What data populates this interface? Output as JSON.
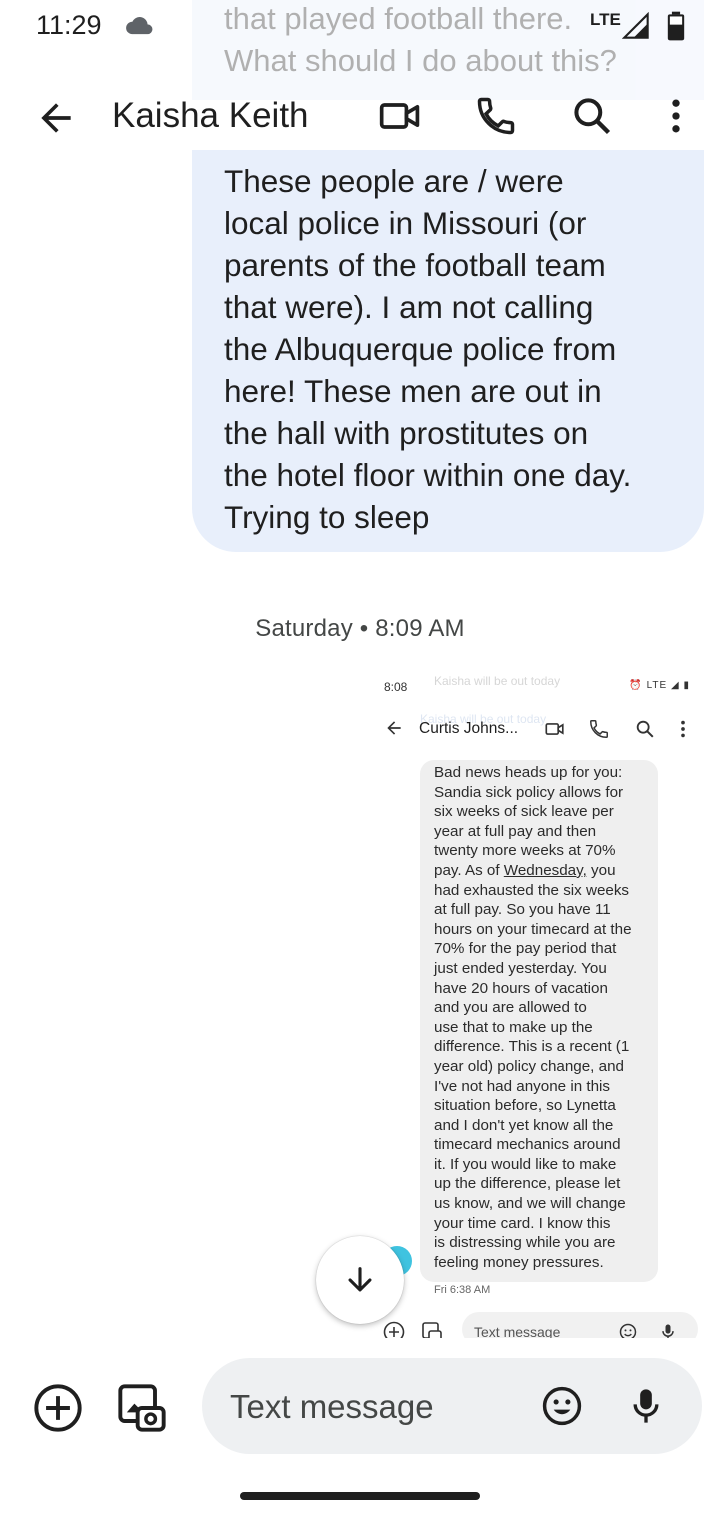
{
  "status_bar": {
    "time": "11:29",
    "network": "LTE",
    "battery_level": "73"
  },
  "header": {
    "contact_name": "Kaisha Keith"
  },
  "conversation": {
    "faded_message_top": "that played football there.\nWhat should I do about this?",
    "message_main": "These people are / were\nlocal police in Missouri (or\nparents of the football team\nthat were). I am not calling\nthe Albuquerque police from\nhere! These men are out in\nthe hall with prostitutes on\nthe hotel floor within one day.\nTrying to sleep",
    "date_separator": "Saturday • 8:09 AM"
  },
  "attachment_screenshot": {
    "status_time": "8:08",
    "status_notif": "Kaisha will be out today",
    "status_notif2": "Kaisha will be out today",
    "status_network": "LTE",
    "contact_name": "Curtis Johns...",
    "message_part1": "Bad news heads up for you:\nSandia sick policy allows for\nsix weeks of sick leave per\nyear at full pay and then\ntwenty more weeks at 70%\npay.  As of ",
    "message_underlined": "Wednesday,",
    "message_part2": " you\nhad exhausted the six weeks\nat full pay.  So you have 11\nhours on your timecard at the\n70% for the pay period that\njust ended yesterday.  You\nhave 20 hours of vacation\nand you are allowed to\nuse that to make up the\ndifference.  This is a recent (1\nyear old) policy change, and\nI've not had anyone in this\nsituation before, so Lynetta\nand I don't yet know all the\ntimecard mechanics around\nit.  If you would like to make\nup the difference, please let\nus know, and we will change\nyour time card.  I know this\nis distressing while you are\nfeeling money pressures.",
    "message_time": "Fri 6:38 AM",
    "compose_placeholder": "Text message"
  },
  "compose": {
    "placeholder": "Text message"
  },
  "colors": {
    "outgoing_bubble": "#e8effb",
    "compose_bg": "#eef0f2",
    "incoming_bubble": "#efefef",
    "avatar": "#3fc3e0"
  }
}
